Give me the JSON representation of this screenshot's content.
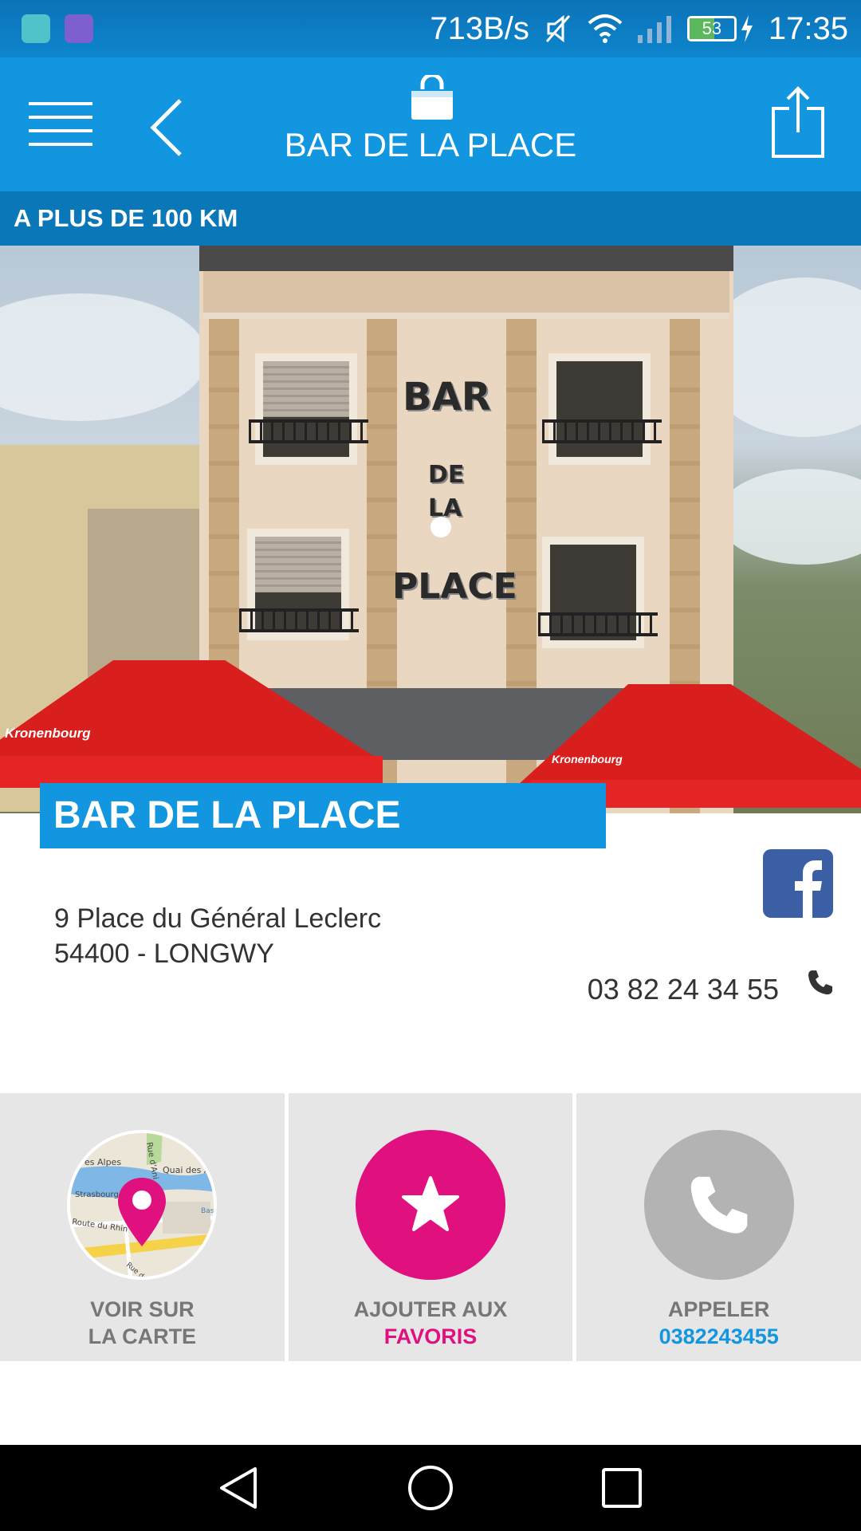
{
  "status_bar": {
    "net_speed": "713B/s",
    "battery": "53",
    "time": "17:35"
  },
  "app_bar": {
    "title": "BAR DE LA PLACE"
  },
  "distance_label": "A PLUS DE 100 KM",
  "hero": {
    "sign_lines": [
      "BAR",
      "DE",
      "LA",
      "PLACE"
    ],
    "umbrella_brand": "Kronenbourg"
  },
  "venue": {
    "name": "BAR DE LA PLACE",
    "address_line1": "9 Place du Général Leclerc",
    "address_line2": "54400 - LONGWY",
    "phone": "03 82 24 34 55"
  },
  "map_labels": {
    "street1": "Rue d'Ani",
    "street2": "Quai des Alp",
    "street3": "es Alpes",
    "street4": "Strasbourg",
    "street5": "Route du Rhin",
    "street6": "Bassi",
    "street7": "Rue de Me"
  },
  "actions": {
    "map_line1": "VOIR SUR",
    "map_line2": "LA CARTE",
    "fav_line1": "AJOUTER AUX",
    "fav_line2": "FAVORIS",
    "call_line1": "APPELER",
    "call_line2": "0382243455"
  },
  "colors": {
    "primary": "#1296df",
    "accent_pink": "#e0117e",
    "tile_bg": "#e6e6e6"
  }
}
